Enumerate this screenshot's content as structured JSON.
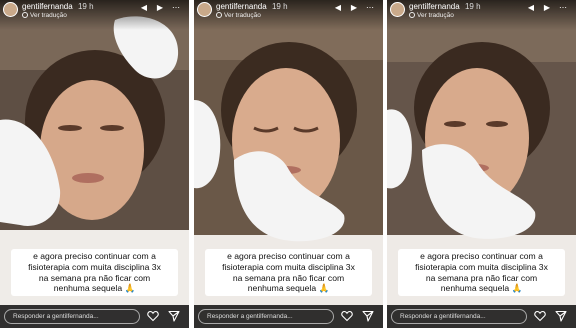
{
  "stories": [
    {
      "username": "gentilfernanda",
      "time": "19 h",
      "translate_label": "Ver tradução",
      "caption_lines": [
        "e agora preciso continuar com a",
        "fisioterapia com muita disciplina 3x",
        "na semana pra não ficar com",
        "nenhuma sequela 🙏"
      ],
      "reply_placeholder": "Responder a gentilfernanda..."
    },
    {
      "username": "gentilfernanda",
      "time": "19 h",
      "translate_label": "Ver tradução",
      "caption_lines": [
        "e agora preciso continuar com a",
        "fisioterapia com muita disciplina 3x",
        "na semana pra não ficar com",
        "nenhuma sequela 🙏"
      ],
      "reply_placeholder": "Responder a gentilfernanda..."
    },
    {
      "username": "gentilfernanda",
      "time": "19 h",
      "translate_label": "Ver tradução",
      "caption_lines": [
        "e agora preciso continuar com a",
        "fisioterapia com muita disciplina 3x",
        "na semana pra não ficar com",
        "nenhuma sequela 🙏"
      ],
      "reply_placeholder": "Responder a gentilfernanda..."
    }
  ],
  "icons": {
    "verified": "verified-badge-icon",
    "mute": "speaker-icon",
    "play": "play-icon",
    "more": "more-dots-icon",
    "like": "heart-icon",
    "share": "send-icon"
  },
  "colors": {
    "overlay": "#000000",
    "caption_bg": "#ffffff",
    "caption_text": "#111111"
  }
}
